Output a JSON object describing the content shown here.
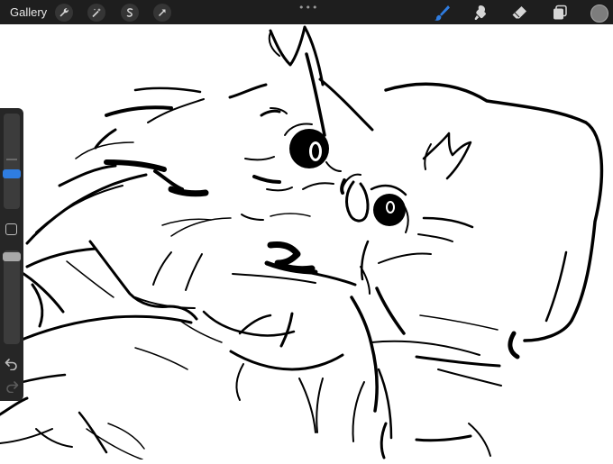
{
  "topbar": {
    "gallery_label": "Gallery",
    "left_tools": [
      {
        "name": "wrench-icon"
      },
      {
        "name": "magic-wand-icon"
      },
      {
        "name": "selection-icon"
      },
      {
        "name": "transform-arrow-icon"
      }
    ],
    "more_label": "•••",
    "right_tools": [
      {
        "name": "brush-icon",
        "active": true
      },
      {
        "name": "smudge-icon"
      },
      {
        "name": "eraser-icon"
      },
      {
        "name": "layers-icon"
      }
    ],
    "active_color": "#7d7d7d"
  },
  "sidebar": {
    "brush_size_level": 0.28,
    "opacity_level": 0.0,
    "icons": [
      "modify-square-icon",
      "undo-icon",
      "redo-icon"
    ]
  },
  "colors": {
    "accent": "#2f7de1",
    "toolbar_bg": "#1e1e1e",
    "sidebar_bg": "#262626"
  }
}
